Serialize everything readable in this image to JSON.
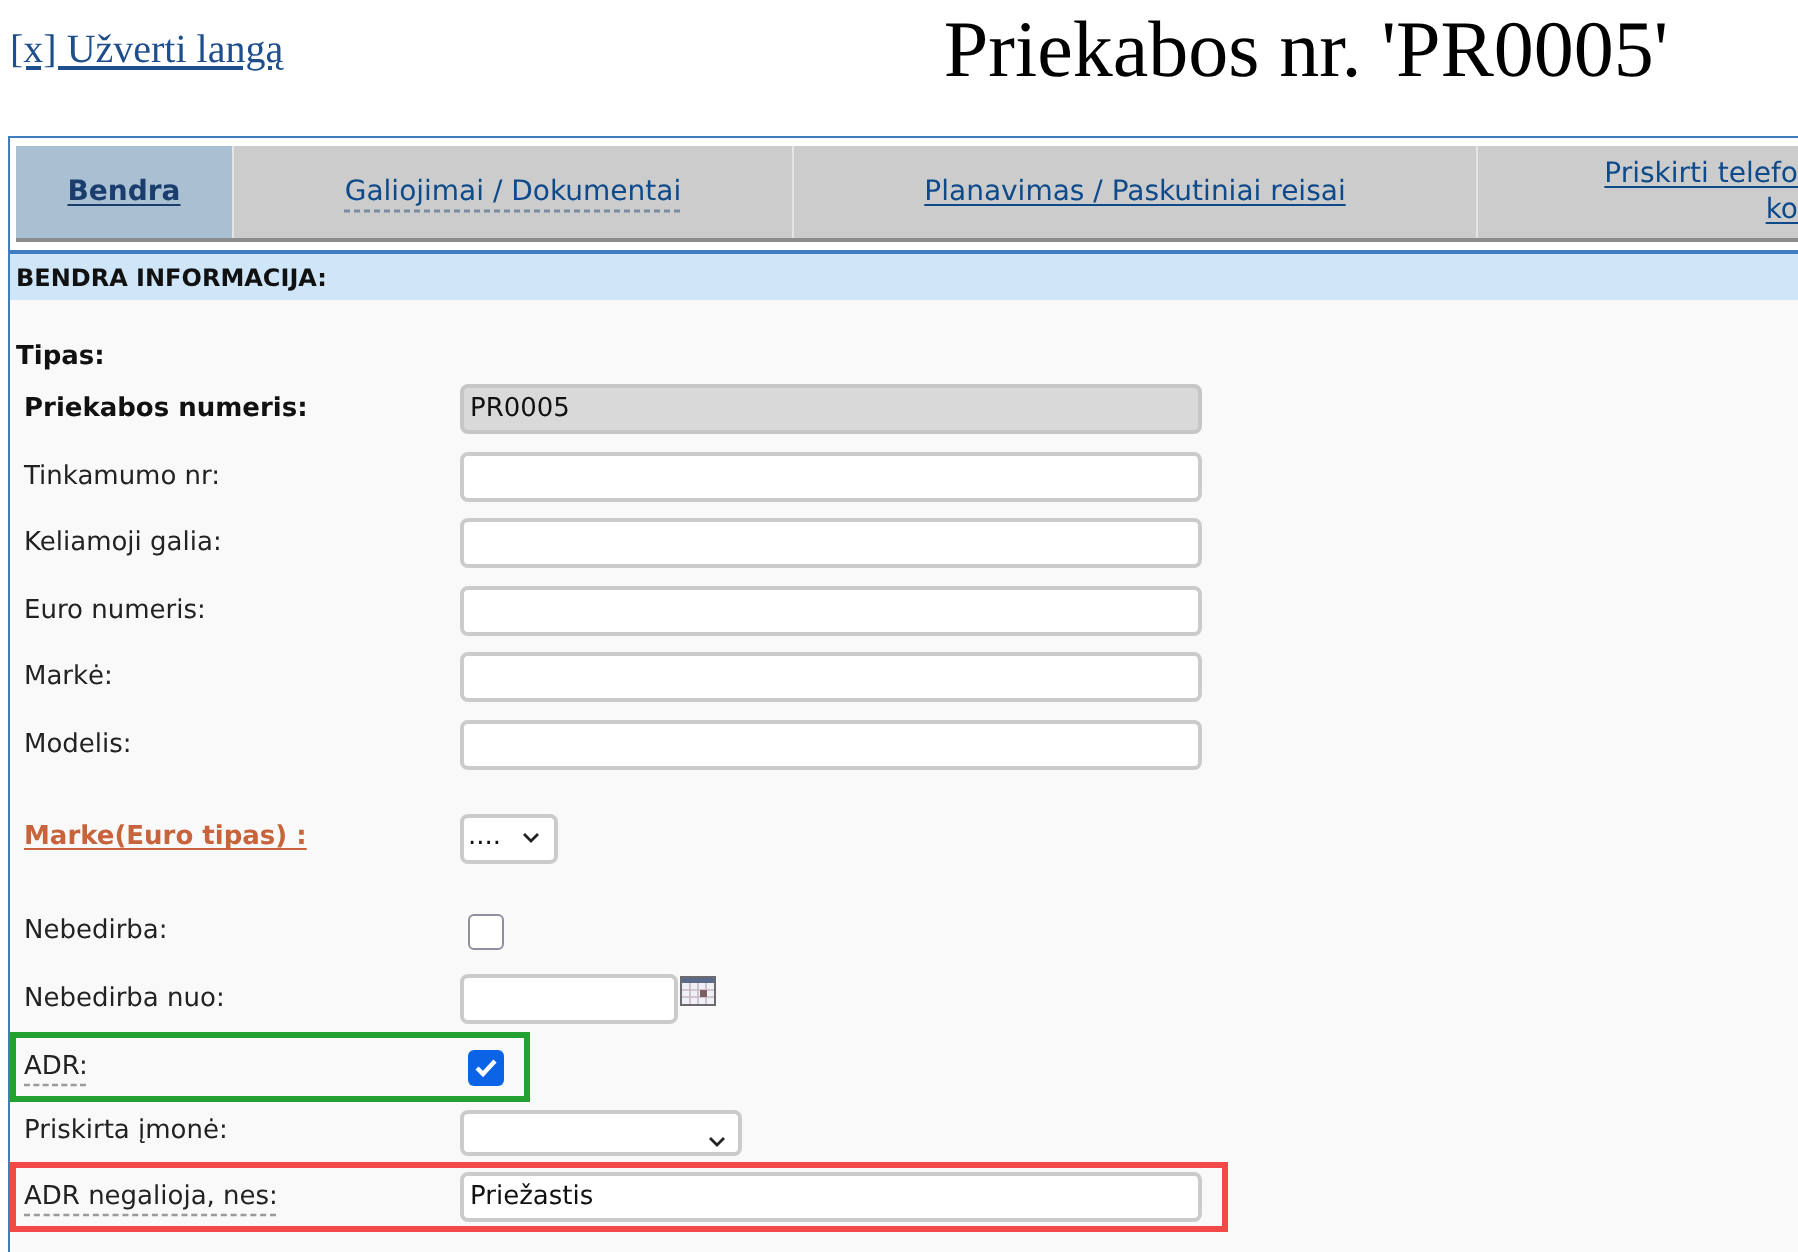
{
  "close_link": "[x] Užverti langą",
  "title": "Priekabos nr. 'PR0005'",
  "tabs": [
    {
      "label": "Bendra",
      "selected": true,
      "hint": false
    },
    {
      "label": "Galiojimai / Dokumentai",
      "selected": false,
      "hint": true
    },
    {
      "label": "Planavimas / Paskutiniai reisai",
      "selected": false,
      "hint": false
    },
    {
      "label": "Priskirti telefo ko",
      "selected": false,
      "hint": false
    }
  ],
  "section": {
    "title": "BENDRA INFORMACIJA:"
  },
  "rows": [
    {
      "kind": "heading",
      "label": "Tipas:",
      "hint": false
    },
    {
      "kind": "id",
      "label": "Priekabos numeris:",
      "hint": false,
      "value": "PR0005",
      "disabled": true
    },
    {
      "kind": "text",
      "label": "Tinkamumo nr:",
      "hint": false,
      "disabled": false
    },
    {
      "kind": "text",
      "label": "Keliamoji galia:",
      "hint": false,
      "disabled": false
    },
    {
      "kind": "text",
      "label": "Euro numeris:",
      "hint": false,
      "disabled": false
    },
    {
      "kind": "text",
      "label": "Markė:",
      "hint": false,
      "disabled": false
    },
    {
      "kind": "text",
      "label": "Modelis:",
      "hint": false,
      "disabled": false
    },
    {
      "kind": "lookup",
      "label": "Marke(Euro tipas) :",
      "hint": false,
      "value": "...."
    },
    {
      "kind": "checkbox",
      "label": "Nebedirba:",
      "hint": false,
      "checked": false
    },
    {
      "kind": "date",
      "label": "Nebedirba nuo:",
      "hint": false
    },
    {
      "kind": "checkbox",
      "label": "ADR:",
      "hint": true,
      "checked": true,
      "highlight": {
        "color": "#22a032"
      }
    },
    {
      "kind": "select",
      "label": "Priskirta įmonė:",
      "hint": false
    },
    {
      "kind": "text",
      "label": "ADR negalioja, nes:",
      "hint": true,
      "value": "Priežastis",
      "disabled": false,
      "highlight": {
        "color": "#f24848"
      }
    }
  ]
}
